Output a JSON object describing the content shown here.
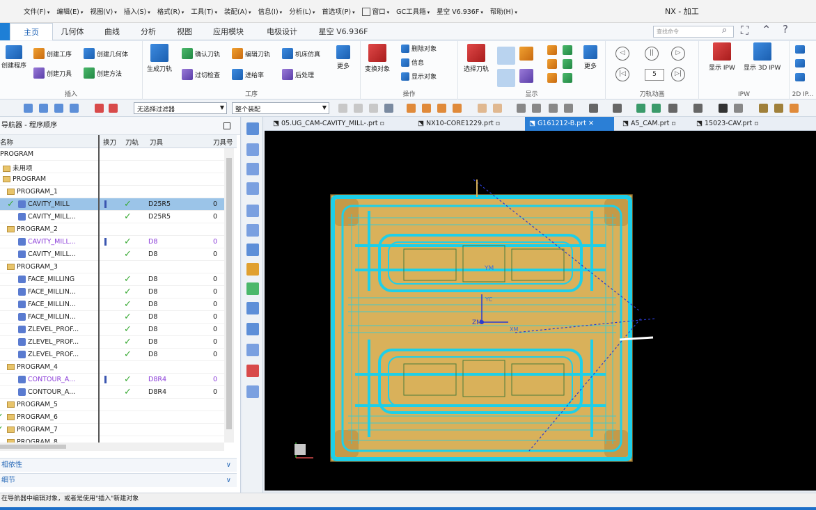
{
  "menubar": {
    "items": [
      "文件(F)",
      "编辑(E)",
      "视图(V)",
      "插入(S)",
      "格式(R)",
      "工具(T)",
      "装配(A)",
      "信息(I)",
      "分析(L)",
      "首选项(P)",
      "窗口",
      "GC工具箱",
      "星空 V6.936F",
      "帮助(H)"
    ],
    "app_title": "NX - 加工"
  },
  "tabs": [
    "主页",
    "几何体",
    "曲线",
    "分析",
    "视图",
    "应用模块",
    "电极设计",
    "星空 V6.936F"
  ],
  "search_placeholder": "查找命令",
  "ribbon": {
    "insert": {
      "title": "插入",
      "buttons": [
        "创建程序",
        "创建工序",
        "创建几何体",
        "创建刀具",
        "创建方法"
      ]
    },
    "ops": {
      "title": "工序",
      "buttons": [
        "生成刀轨",
        "确认刀轨",
        "编辑刀轨",
        "机床仿真",
        "过切检查",
        "进给率",
        "后处理",
        "更多"
      ]
    },
    "actions": {
      "title": "操作",
      "buttons": [
        "变换对象",
        "删除对象",
        "信息",
        "显示对象"
      ]
    },
    "display": {
      "title": "显示",
      "buttons": [
        "选择刀轨",
        "更多"
      ]
    },
    "anim": {
      "title": "刀轨动画",
      "speed": "5"
    },
    "ipw": {
      "title": "IPW",
      "buttons": [
        "显示 IPW",
        "显示 3D IPW"
      ]
    },
    "twod": {
      "title": "2D IP..."
    }
  },
  "toolbar2": {
    "filter": "无选择过滤器",
    "scope": "整个装配"
  },
  "navigator": {
    "title": "导航器 - 程序顺序",
    "columns": [
      "名称",
      "换刀",
      "刀轨",
      "刀具",
      "刀具号"
    ],
    "rows": [
      {
        "name": "PROGRAM",
        "indent": 0,
        "type": "root",
        "tool": "",
        "zero": ""
      },
      {
        "name": "未用项",
        "indent": 1,
        "type": "folder",
        "tool": "",
        "zero": ""
      },
      {
        "name": "PROGRAM",
        "indent": 1,
        "type": "folder",
        "tool": "",
        "zero": ""
      },
      {
        "name": "PROGRAM_1",
        "indent": 2,
        "type": "folder",
        "tool": "",
        "zero": ""
      },
      {
        "name": "CAVITY_MILL",
        "indent": 3,
        "type": "op",
        "tool": "D25R5",
        "zero": "0",
        "bar": true,
        "check": true,
        "sel": true,
        "pre": true
      },
      {
        "name": "CAVITY_MILL...",
        "indent": 3,
        "type": "op",
        "tool": "D25R5",
        "zero": "0",
        "check": true
      },
      {
        "name": "PROGRAM_2",
        "indent": 2,
        "type": "folder",
        "tool": "",
        "zero": ""
      },
      {
        "name": "CAVITY_MILL...",
        "indent": 3,
        "type": "op",
        "tool": "D8",
        "zero": "0",
        "bar": true,
        "check": true,
        "purple": true
      },
      {
        "name": "CAVITY_MILL...",
        "indent": 3,
        "type": "op",
        "tool": "D8",
        "zero": "0",
        "check": true
      },
      {
        "name": "PROGRAM_3",
        "indent": 2,
        "type": "folder",
        "tool": "",
        "zero": ""
      },
      {
        "name": "FACE_MILLING",
        "indent": 3,
        "type": "op",
        "tool": "D8",
        "zero": "0",
        "check": true
      },
      {
        "name": "FACE_MILLIN...",
        "indent": 3,
        "type": "op",
        "tool": "D8",
        "zero": "0",
        "check": true
      },
      {
        "name": "FACE_MILLIN...",
        "indent": 3,
        "type": "op",
        "tool": "D8",
        "zero": "0",
        "check": true
      },
      {
        "name": "FACE_MILLIN...",
        "indent": 3,
        "type": "op",
        "tool": "D8",
        "zero": "0",
        "check": true
      },
      {
        "name": "ZLEVEL_PROF...",
        "indent": 3,
        "type": "op",
        "tool": "D8",
        "zero": "0",
        "check": true
      },
      {
        "name": "ZLEVEL_PROF...",
        "indent": 3,
        "type": "op",
        "tool": "D8",
        "zero": "0",
        "check": true
      },
      {
        "name": "ZLEVEL_PROF...",
        "indent": 3,
        "type": "op",
        "tool": "D8",
        "zero": "0",
        "check": true
      },
      {
        "name": "PROGRAM_4",
        "indent": 2,
        "type": "folder",
        "tool": "",
        "zero": ""
      },
      {
        "name": "CONTOUR_A...",
        "indent": 3,
        "type": "op",
        "tool": "D8R4",
        "zero": "0",
        "bar": true,
        "check": true,
        "purple": true
      },
      {
        "name": "CONTOUR_A...",
        "indent": 3,
        "type": "op",
        "tool": "D8R4",
        "zero": "0",
        "check": true
      },
      {
        "name": "PROGRAM_5",
        "indent": 2,
        "type": "folder",
        "tool": "",
        "zero": ""
      },
      {
        "name": "PROGRAM_6",
        "indent": 2,
        "type": "folder",
        "tool": "",
        "zero": "",
        "pre": true
      },
      {
        "name": "PROGRAM_7",
        "indent": 2,
        "type": "folder",
        "tool": "",
        "zero": "",
        "pre": true
      },
      {
        "name": "PROGRAM_8",
        "indent": 2,
        "type": "folder",
        "tool": "",
        "zero": ""
      }
    ],
    "sections": [
      "相依性",
      "细节"
    ]
  },
  "doc_tabs": [
    {
      "label": "05.UG_CAM-CAVITY_MILL-.prt",
      "active": false
    },
    {
      "label": "NX10-CORE1229.prt",
      "active": false
    },
    {
      "label": "G161212-B.prt",
      "active": true
    },
    {
      "label": "A5_CAM.prt",
      "active": false
    },
    {
      "label": "15023-CAV.prt",
      "active": false
    }
  ],
  "viewport": {
    "labels": [
      "YM",
      "YC",
      "ZM",
      "XM"
    ]
  },
  "status": "在导航器中编辑对象，或者是使用\"插入\"新建对象",
  "colors": {
    "accent": "#1e7fd6",
    "toolpath": "#1ecfe8",
    "part": "#d9b15a",
    "check": "#3aaa35",
    "selected_row": "#9bc4e8",
    "purple": "#8a3cd8"
  }
}
